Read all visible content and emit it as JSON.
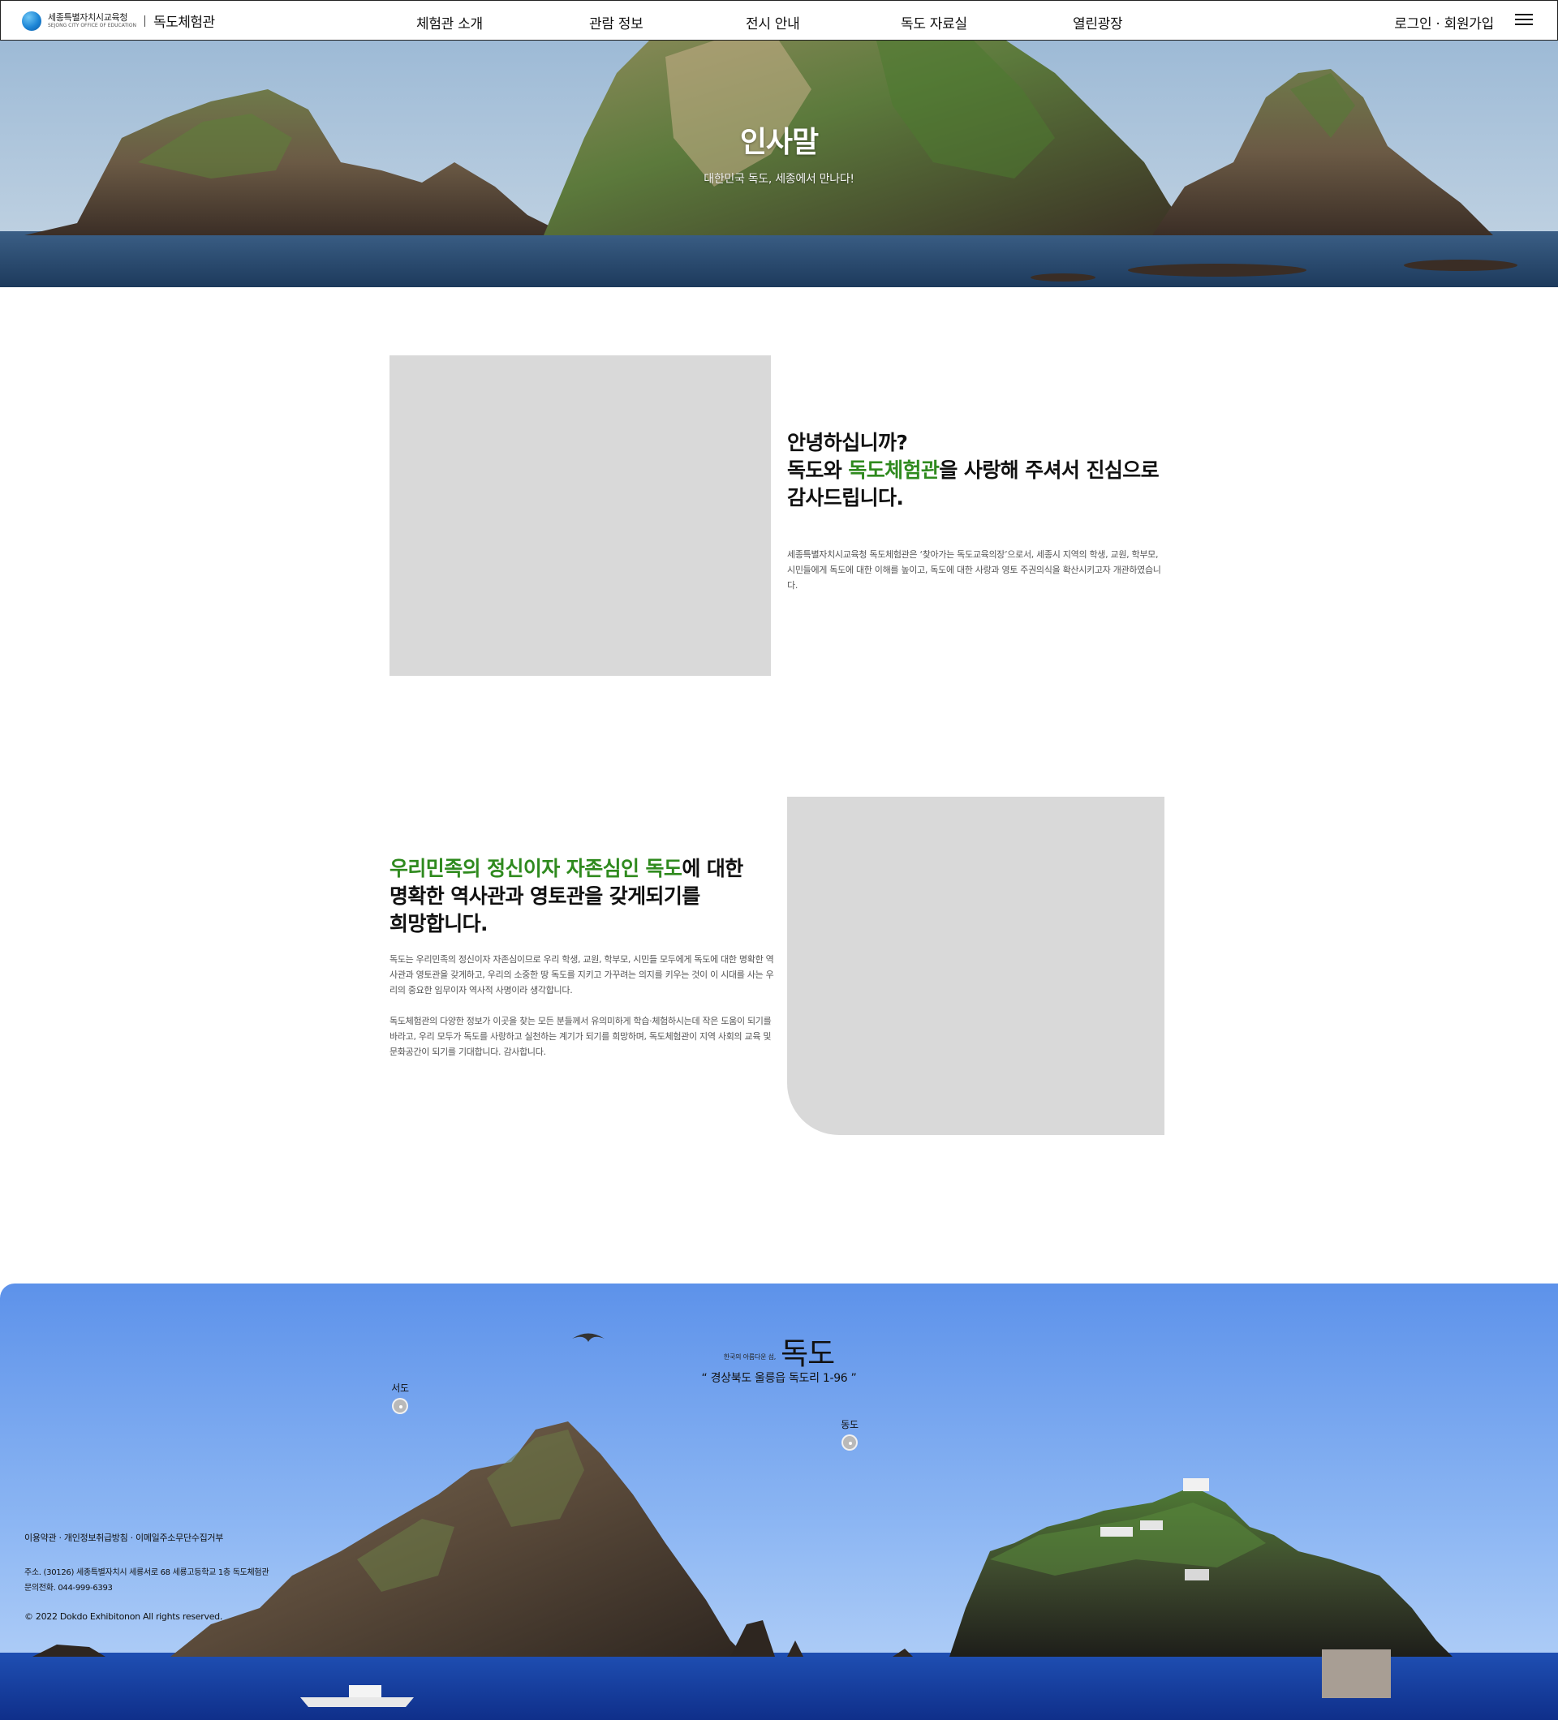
{
  "header": {
    "org_name": "세종특별자치시교육청",
    "org_name_en": "SEJONG CITY OFFICE OF EDUCATION",
    "site_name": "독도체험관",
    "nav": [
      "체험관 소개",
      "관람 정보",
      "전시 안내",
      "독도 자료실",
      "열린광장"
    ],
    "login": "로그인",
    "separator": " · ",
    "signup": "회원가입",
    "menu_icon": "hamburger-menu-icon"
  },
  "hero": {
    "title": "인사말",
    "subtitle": "대한민국 독도, 세종에서 만나다!"
  },
  "section1": {
    "heading_line1": "안녕하십니까?",
    "heading_pre": "독도와 ",
    "heading_highlight": "독도체험관",
    "heading_post": "을 사랑해 주셔서 진심으로",
    "heading_line3": "감사드립니다.",
    "body": "세종특별자치시교육청 독도체험관은 ‘찾아가는 독도교육의장’으로서, 세종시 지역의 학생, 교원, 학부모, 시민들에게 독도에 대한 이해를 높이고, 독도에 대한 사랑과 영토 주권의식을 확산시키고자 개관하였습니다."
  },
  "section2": {
    "heading_highlight": "우리민족의 정신이자 자존심인 독도",
    "heading_post": "에 대한",
    "heading_line2": "명확한 역사관과 영토관을 갖게되기를",
    "heading_line3": "희망합니다.",
    "body1": "독도는 우리민족의 정신이자 자존심이므로 우리 학생, 교원, 학부모, 시민들 모두에게 독도에 대한 명확한 역사관과 영토관을 갖게하고, 우리의 소중한 땅 독도를 지키고 가꾸려는 의지를 키우는 것이 이 시대를 사는 우리의 중요한 임무이자 역사적 사명이라 생각합니다.",
    "body2": "독도체험관의 다양한 정보가 이곳을 찾는 모든 분들께서 유의미하게 학습·체험하시는데 작은 도움이 되기를 바라고, 우리 모두가 독도를 사랑하고 실천하는 계기가 되기를 희망하며, 독도체험관이 지역 사회의 교육 및 문화공간이 되기를 기대합니다. 감사합니다."
  },
  "dokdo": {
    "small_label": "한국의 아름다운 섬,",
    "name": "독도",
    "address": "“ 경상북도 울릉읍 독도리 1-96 ”",
    "west_island": "서도",
    "east_island": "동도"
  },
  "footer": {
    "link_terms": "이용약관",
    "link_privacy": "개인정보취급방침",
    "link_email": "이메일주소무단수집거부",
    "link_sep": " · ",
    "address": "주소. (30126) 세종특별자치시 세룡서로 68 세룡고등학교 1층 독도체험관",
    "phone": "문의전화. 044-999-6393",
    "copyright": "© 2022 Dokdo Exhibitonon All rights reserved."
  },
  "colors": {
    "accent_green": "#2f8a1e",
    "placeholder_gray": "#d9d9d9",
    "top_button": "#a89e94"
  }
}
